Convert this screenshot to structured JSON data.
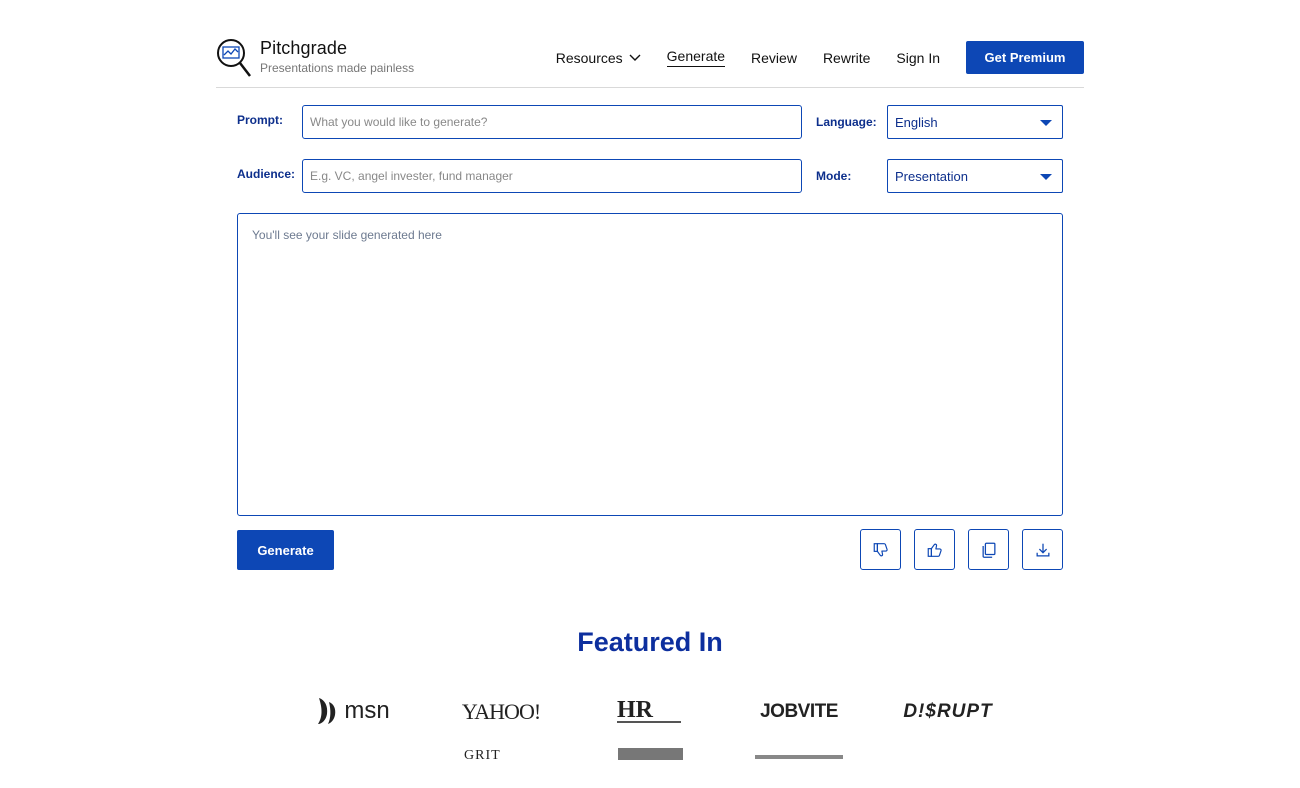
{
  "header": {
    "brand_name": "Pitchgrade",
    "brand_tagline": "Presentations made painless",
    "nav": {
      "resources": "Resources",
      "generate": "Generate",
      "review": "Review",
      "rewrite": "Rewrite",
      "sign_in": "Sign In"
    },
    "cta": "Get Premium"
  },
  "form": {
    "prompt_label": "Prompt:",
    "prompt_placeholder": "What you would like to generate?",
    "prompt_value": "",
    "audience_label": "Audience:",
    "audience_placeholder": "E.g. VC, angel invester, fund manager",
    "audience_value": "",
    "language_label": "Language:",
    "language_selected": "English",
    "mode_label": "Mode:",
    "mode_selected": "Presentation"
  },
  "output": {
    "placeholder": "You'll see your slide generated here"
  },
  "actions": {
    "generate_label": "Generate",
    "icons": [
      "thumbs-down-icon",
      "thumbs-up-icon",
      "copy-icon",
      "download-icon"
    ]
  },
  "featured": {
    "title": "Featured In",
    "logos": {
      "msn": "msn",
      "yahoo": "YAHOO!",
      "hr": "HR.com",
      "jobvite": "JOBVITE",
      "disrupt": "D!$RUPT",
      "grit": "GRIT DAILY",
      "shrm": "SHRM"
    }
  },
  "colors": {
    "primary": "#0d47b5",
    "label": "#0d2f8c",
    "heading": "#0d2f9e"
  }
}
